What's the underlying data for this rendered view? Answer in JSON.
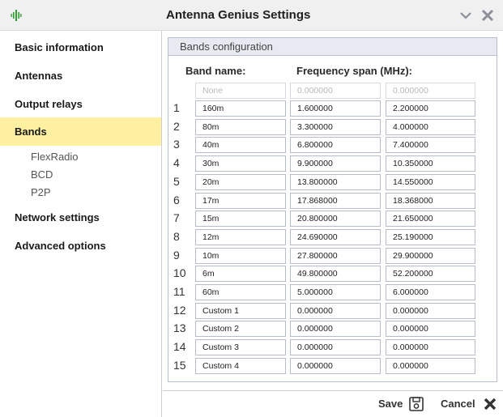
{
  "window": {
    "title": "Antenna Genius Settings",
    "app_icon": "antenna-icon",
    "minimize_icon": "chevron-down-icon",
    "close_icon": "close-icon"
  },
  "sidebar": {
    "items": [
      {
        "label": "Basic information"
      },
      {
        "label": "Antennas"
      },
      {
        "label": "Output relays"
      },
      {
        "label": "Bands",
        "active": true
      },
      {
        "label": "Network settings"
      },
      {
        "label": "Advanced options"
      }
    ],
    "subitems": [
      "FlexRadio",
      "BCD",
      "P2P"
    ]
  },
  "main": {
    "section_title": "Bands configuration",
    "band_name_header": "Band name:",
    "frequency_header": "Frequency span (MHz):",
    "placeholder_row": {
      "name": "None",
      "from": "0.000000",
      "to": "0.000000"
    },
    "bands": [
      {
        "num": "1",
        "name": "160m",
        "from": "1.600000",
        "to": "2.200000"
      },
      {
        "num": "2",
        "name": "80m",
        "from": "3.300000",
        "to": "4.000000"
      },
      {
        "num": "3",
        "name": "40m",
        "from": "6.800000",
        "to": "7.400000"
      },
      {
        "num": "4",
        "name": "30m",
        "from": "9.900000",
        "to": "10.350000"
      },
      {
        "num": "5",
        "name": "20m",
        "from": "13.800000",
        "to": "14.550000"
      },
      {
        "num": "6",
        "name": "17m",
        "from": "17.868000",
        "to": "18.368000"
      },
      {
        "num": "7",
        "name": "15m",
        "from": "20.800000",
        "to": "21.650000"
      },
      {
        "num": "8",
        "name": "12m",
        "from": "24.690000",
        "to": "25.190000"
      },
      {
        "num": "9",
        "name": "10m",
        "from": "27.800000",
        "to": "29.900000"
      },
      {
        "num": "10",
        "name": "6m",
        "from": "49.800000",
        "to": "52.200000"
      },
      {
        "num": "11",
        "name": "60m",
        "from": "5.000000",
        "to": "6.000000"
      },
      {
        "num": "12",
        "name": "Custom 1",
        "from": "0.000000",
        "to": "0.000000"
      },
      {
        "num": "13",
        "name": "Custom 2",
        "from": "0.000000",
        "to": "0.000000"
      },
      {
        "num": "14",
        "name": "Custom 3",
        "from": "0.000000",
        "to": "0.000000"
      },
      {
        "num": "15",
        "name": "Custom 4",
        "from": "0.000000",
        "to": "0.000000"
      }
    ]
  },
  "footer": {
    "save_label": "Save",
    "save_icon": "save-icon",
    "cancel_label": "Cancel",
    "cancel_icon": "close-icon"
  },
  "colors": {
    "active_nav_bg": "#fdf0a0",
    "header_bg": "#e7eaf1",
    "input_border": "#b7bccb",
    "app_icon_green": "#2e9e2e"
  }
}
